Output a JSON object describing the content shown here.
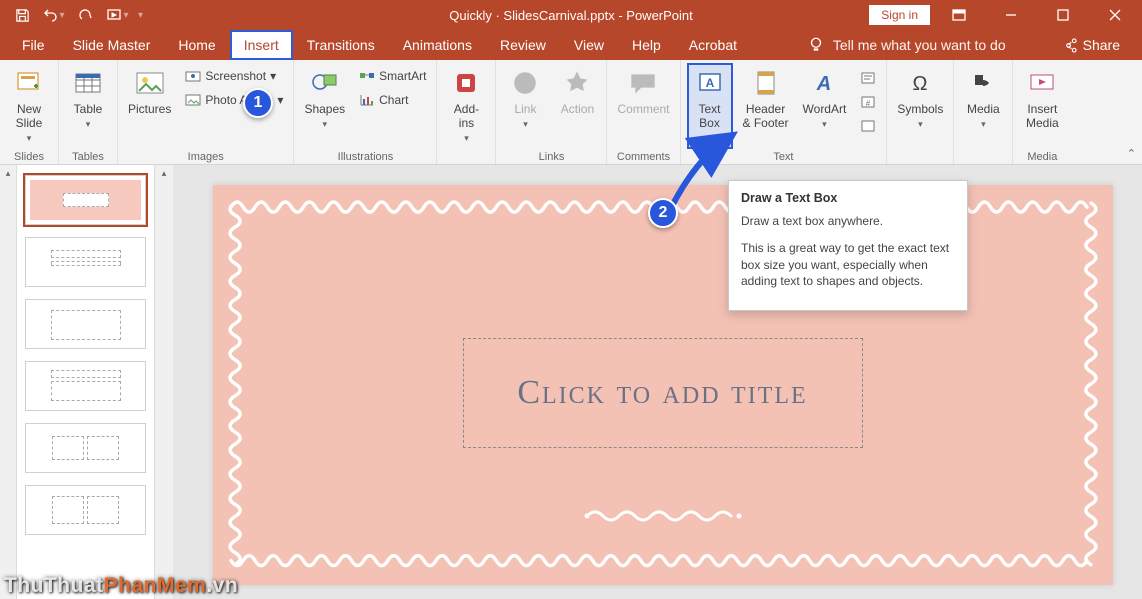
{
  "title": {
    "doc": "Quickly · SlidesCarnival.pptx",
    "app": "PowerPoint"
  },
  "signin": "Sign in",
  "tabs": {
    "file": "File",
    "slidemaster": "Slide Master",
    "home": "Home",
    "insert": "Insert",
    "transitions": "Transitions",
    "animations": "Animations",
    "review": "Review",
    "view": "View",
    "help": "Help",
    "acrobat": "Acrobat",
    "tellme": "Tell me what you want to do",
    "share": "Share"
  },
  "ribbon": {
    "slides": {
      "group": "Slides",
      "newslide": "New\nSlide"
    },
    "tables": {
      "group": "Tables",
      "table": "Table"
    },
    "images": {
      "group": "Images",
      "pictures": "Pictures",
      "screenshot": "Screenshot",
      "photoalbum": "Photo Album"
    },
    "illustrations": {
      "group": "Illustrations",
      "shapes": "Shapes",
      "smartart": "SmartArt",
      "chart": "Chart"
    },
    "addins": {
      "group": "",
      "addins": "Add-\nins"
    },
    "links": {
      "group": "Links",
      "link": "Link",
      "action": "Action"
    },
    "comments": {
      "group": "Comments",
      "comment": "Comment"
    },
    "text": {
      "group": "Text",
      "textbox": "Text\nBox",
      "headerfooter": "Header\n& Footer",
      "wordart": "WordArt"
    },
    "symbols": {
      "group": "",
      "symbols": "Symbols"
    },
    "media": {
      "group": "",
      "media": "Media"
    },
    "insertmedia": {
      "group": "Media",
      "insert": "Insert\nMedia"
    }
  },
  "tooltip": {
    "title": "Draw a Text Box",
    "p1": "Draw a text box anywhere.",
    "p2": "This is a great way to get the exact text box size you want, especially when adding text to shapes and objects."
  },
  "slide": {
    "title_placeholder": "Click to add title"
  },
  "annotations": {
    "step1": "1",
    "step2": "2"
  },
  "watermark": {
    "a": "ThuThuat",
    "b": "PhanMem",
    "c": ".vn"
  }
}
